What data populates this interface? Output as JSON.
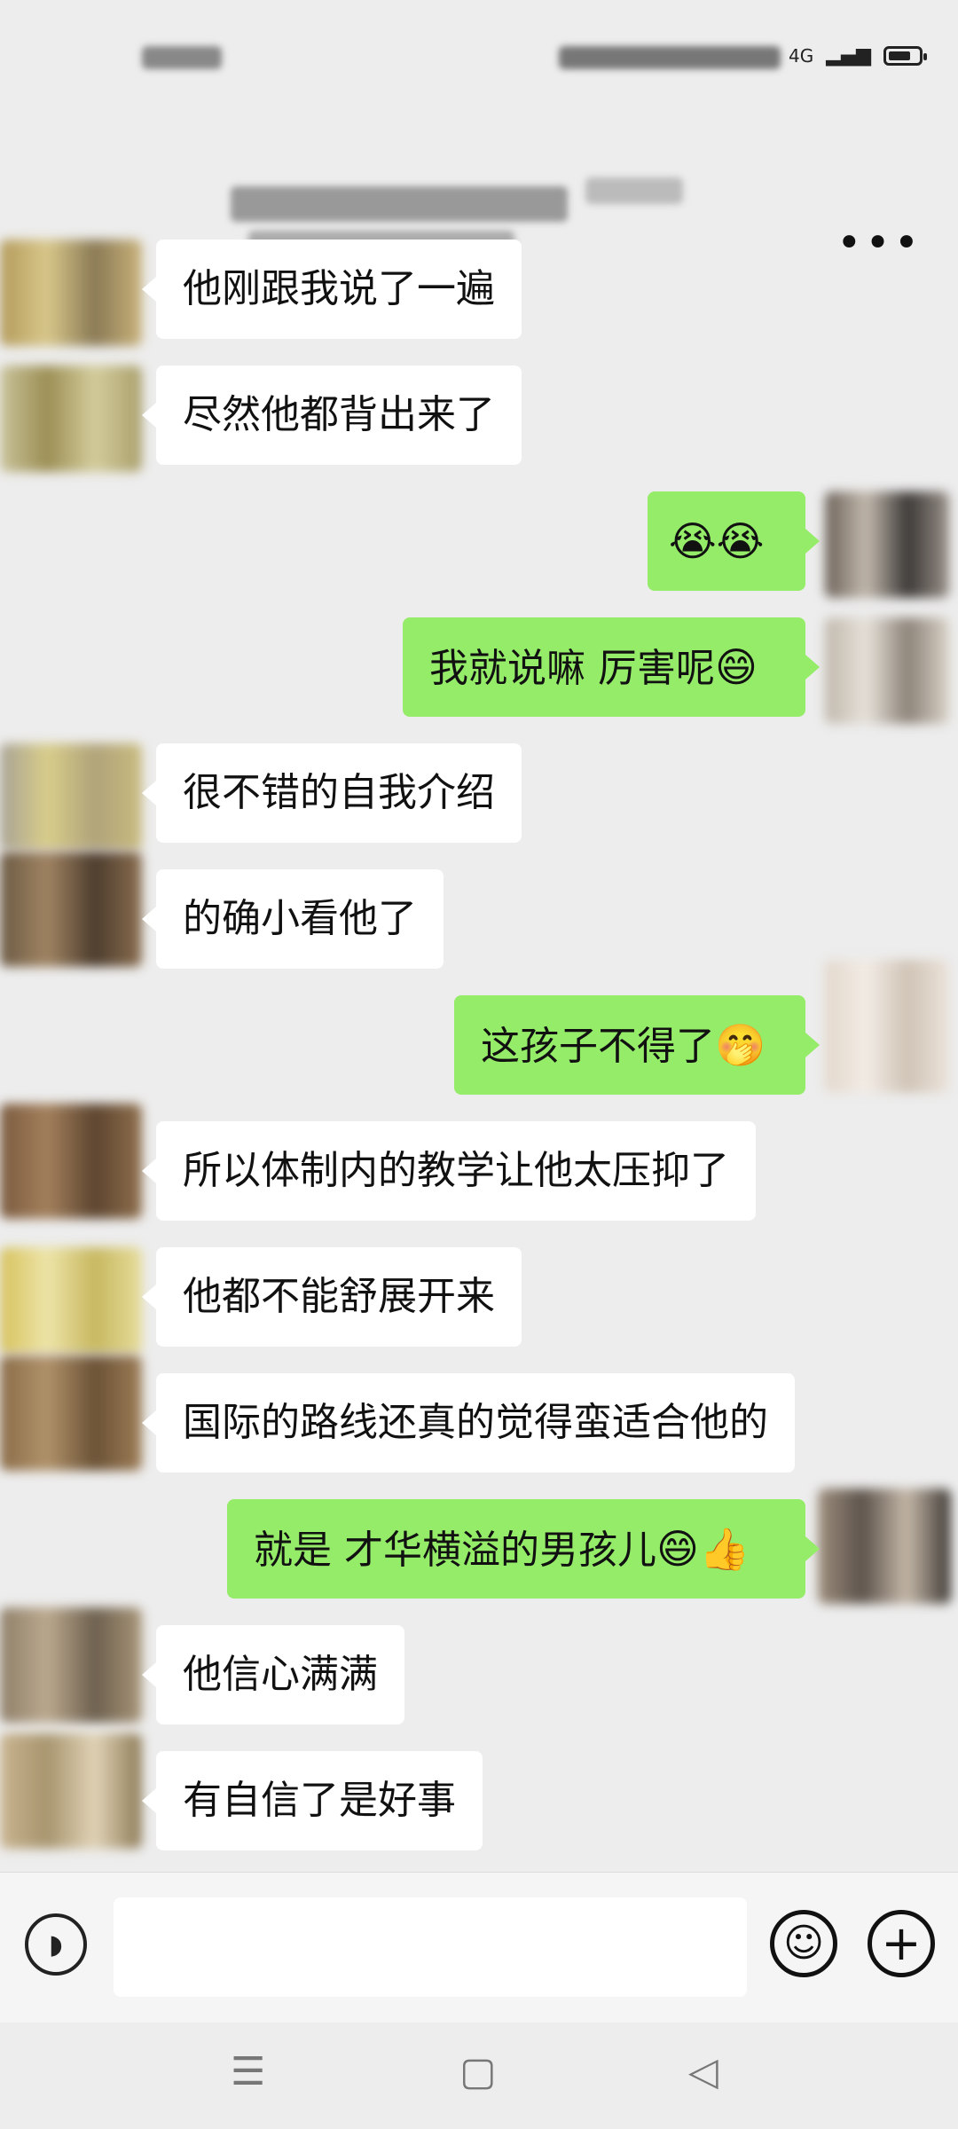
{
  "status_bar": {
    "network": "4G"
  },
  "title_bar": {
    "more_label": "•••"
  },
  "messages": [
    {
      "side": "left",
      "text": "他刚跟我说了一遍",
      "emoji": ""
    },
    {
      "side": "left",
      "text": "尽然他都背出来了",
      "emoji": ""
    },
    {
      "side": "right",
      "text": "",
      "emoji": "😭😭"
    },
    {
      "side": "right",
      "text": "我就说嘛 厉害呢",
      "emoji": "😄"
    },
    {
      "side": "left",
      "text": "很不错的自我介绍",
      "emoji": ""
    },
    {
      "side": "left",
      "text": "的确小看他了",
      "emoji": ""
    },
    {
      "side": "right",
      "text": "这孩子不得了",
      "emoji": "🤭"
    },
    {
      "side": "left",
      "text": "所以体制内的教学让他太压抑了",
      "emoji": ""
    },
    {
      "side": "left",
      "text": "他都不能舒展开来",
      "emoji": ""
    },
    {
      "side": "left",
      "text": "国际的路线还真的觉得蛮适合他的",
      "emoji": ""
    },
    {
      "side": "right",
      "text": "就是 才华横溢的男孩儿",
      "emoji": "😄👍"
    },
    {
      "side": "left",
      "text": "他信心满满",
      "emoji": ""
    },
    {
      "side": "left",
      "text": "有自信了是好事",
      "emoji": ""
    }
  ],
  "input_bar": {
    "placeholder": "",
    "emoji_icon": "☺",
    "plus_icon": "+",
    "voice_icon": "◗"
  },
  "nav_bar": {
    "menu_icon": "☰",
    "home_icon": "▢",
    "back_icon": "◁"
  },
  "colors": {
    "background": "#ededed",
    "bubble_right": "#95ec69",
    "bubble_left": "#ffffff"
  }
}
